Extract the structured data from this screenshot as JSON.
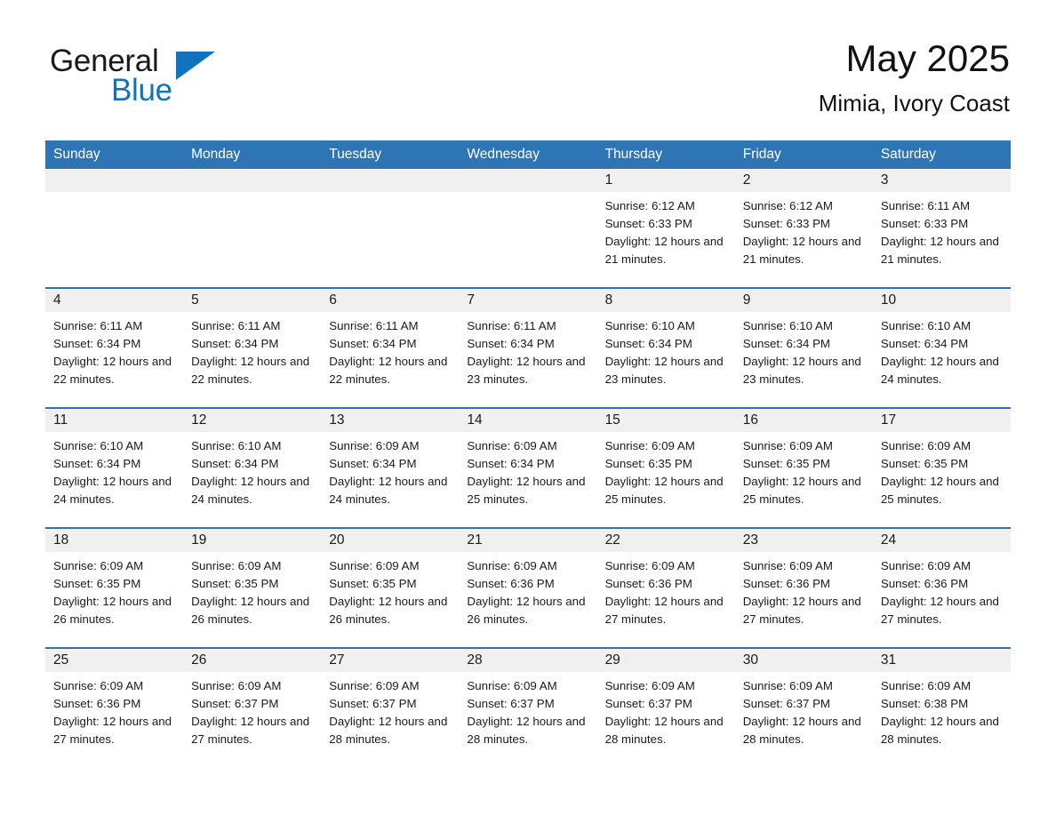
{
  "brand": {
    "name_part1": "General",
    "name_part2": "Blue",
    "accent_color": "#1073bd",
    "triangle_icon": "triangle-icon"
  },
  "header": {
    "title": "May 2025",
    "subtitle": "Mimia, Ivory Coast"
  },
  "theme": {
    "header_blue": "#2e75b6",
    "date_band_gray": "#f0f0f0",
    "text_black": "#1a1a1a"
  },
  "calendar": {
    "weekdays": [
      "Sunday",
      "Monday",
      "Tuesday",
      "Wednesday",
      "Thursday",
      "Friday",
      "Saturday"
    ],
    "weeks": [
      [
        {
          "day": "",
          "empty": true
        },
        {
          "day": "",
          "empty": true
        },
        {
          "day": "",
          "empty": true
        },
        {
          "day": "",
          "empty": true
        },
        {
          "day": "1",
          "sunrise": "Sunrise: 6:12 AM",
          "sunset": "Sunset: 6:33 PM",
          "daylight": "Daylight: 12 hours and 21 minutes."
        },
        {
          "day": "2",
          "sunrise": "Sunrise: 6:12 AM",
          "sunset": "Sunset: 6:33 PM",
          "daylight": "Daylight: 12 hours and 21 minutes."
        },
        {
          "day": "3",
          "sunrise": "Sunrise: 6:11 AM",
          "sunset": "Sunset: 6:33 PM",
          "daylight": "Daylight: 12 hours and 21 minutes."
        }
      ],
      [
        {
          "day": "4",
          "sunrise": "Sunrise: 6:11 AM",
          "sunset": "Sunset: 6:34 PM",
          "daylight": "Daylight: 12 hours and 22 minutes."
        },
        {
          "day": "5",
          "sunrise": "Sunrise: 6:11 AM",
          "sunset": "Sunset: 6:34 PM",
          "daylight": "Daylight: 12 hours and 22 minutes."
        },
        {
          "day": "6",
          "sunrise": "Sunrise: 6:11 AM",
          "sunset": "Sunset: 6:34 PM",
          "daylight": "Daylight: 12 hours and 22 minutes."
        },
        {
          "day": "7",
          "sunrise": "Sunrise: 6:11 AM",
          "sunset": "Sunset: 6:34 PM",
          "daylight": "Daylight: 12 hours and 23 minutes."
        },
        {
          "day": "8",
          "sunrise": "Sunrise: 6:10 AM",
          "sunset": "Sunset: 6:34 PM",
          "daylight": "Daylight: 12 hours and 23 minutes."
        },
        {
          "day": "9",
          "sunrise": "Sunrise: 6:10 AM",
          "sunset": "Sunset: 6:34 PM",
          "daylight": "Daylight: 12 hours and 23 minutes."
        },
        {
          "day": "10",
          "sunrise": "Sunrise: 6:10 AM",
          "sunset": "Sunset: 6:34 PM",
          "daylight": "Daylight: 12 hours and 24 minutes."
        }
      ],
      [
        {
          "day": "11",
          "sunrise": "Sunrise: 6:10 AM",
          "sunset": "Sunset: 6:34 PM",
          "daylight": "Daylight: 12 hours and 24 minutes."
        },
        {
          "day": "12",
          "sunrise": "Sunrise: 6:10 AM",
          "sunset": "Sunset: 6:34 PM",
          "daylight": "Daylight: 12 hours and 24 minutes."
        },
        {
          "day": "13",
          "sunrise": "Sunrise: 6:09 AM",
          "sunset": "Sunset: 6:34 PM",
          "daylight": "Daylight: 12 hours and 24 minutes."
        },
        {
          "day": "14",
          "sunrise": "Sunrise: 6:09 AM",
          "sunset": "Sunset: 6:34 PM",
          "daylight": "Daylight: 12 hours and 25 minutes."
        },
        {
          "day": "15",
          "sunrise": "Sunrise: 6:09 AM",
          "sunset": "Sunset: 6:35 PM",
          "daylight": "Daylight: 12 hours and 25 minutes."
        },
        {
          "day": "16",
          "sunrise": "Sunrise: 6:09 AM",
          "sunset": "Sunset: 6:35 PM",
          "daylight": "Daylight: 12 hours and 25 minutes."
        },
        {
          "day": "17",
          "sunrise": "Sunrise: 6:09 AM",
          "sunset": "Sunset: 6:35 PM",
          "daylight": "Daylight: 12 hours and 25 minutes."
        }
      ],
      [
        {
          "day": "18",
          "sunrise": "Sunrise: 6:09 AM",
          "sunset": "Sunset: 6:35 PM",
          "daylight": "Daylight: 12 hours and 26 minutes."
        },
        {
          "day": "19",
          "sunrise": "Sunrise: 6:09 AM",
          "sunset": "Sunset: 6:35 PM",
          "daylight": "Daylight: 12 hours and 26 minutes."
        },
        {
          "day": "20",
          "sunrise": "Sunrise: 6:09 AM",
          "sunset": "Sunset: 6:35 PM",
          "daylight": "Daylight: 12 hours and 26 minutes."
        },
        {
          "day": "21",
          "sunrise": "Sunrise: 6:09 AM",
          "sunset": "Sunset: 6:36 PM",
          "daylight": "Daylight: 12 hours and 26 minutes."
        },
        {
          "day": "22",
          "sunrise": "Sunrise: 6:09 AM",
          "sunset": "Sunset: 6:36 PM",
          "daylight": "Daylight: 12 hours and 27 minutes."
        },
        {
          "day": "23",
          "sunrise": "Sunrise: 6:09 AM",
          "sunset": "Sunset: 6:36 PM",
          "daylight": "Daylight: 12 hours and 27 minutes."
        },
        {
          "day": "24",
          "sunrise": "Sunrise: 6:09 AM",
          "sunset": "Sunset: 6:36 PM",
          "daylight": "Daylight: 12 hours and 27 minutes."
        }
      ],
      [
        {
          "day": "25",
          "sunrise": "Sunrise: 6:09 AM",
          "sunset": "Sunset: 6:36 PM",
          "daylight": "Daylight: 12 hours and 27 minutes."
        },
        {
          "day": "26",
          "sunrise": "Sunrise: 6:09 AM",
          "sunset": "Sunset: 6:37 PM",
          "daylight": "Daylight: 12 hours and 27 minutes."
        },
        {
          "day": "27",
          "sunrise": "Sunrise: 6:09 AM",
          "sunset": "Sunset: 6:37 PM",
          "daylight": "Daylight: 12 hours and 28 minutes."
        },
        {
          "day": "28",
          "sunrise": "Sunrise: 6:09 AM",
          "sunset": "Sunset: 6:37 PM",
          "daylight": "Daylight: 12 hours and 28 minutes."
        },
        {
          "day": "29",
          "sunrise": "Sunrise: 6:09 AM",
          "sunset": "Sunset: 6:37 PM",
          "daylight": "Daylight: 12 hours and 28 minutes."
        },
        {
          "day": "30",
          "sunrise": "Sunrise: 6:09 AM",
          "sunset": "Sunset: 6:37 PM",
          "daylight": "Daylight: 12 hours and 28 minutes."
        },
        {
          "day": "31",
          "sunrise": "Sunrise: 6:09 AM",
          "sunset": "Sunset: 6:38 PM",
          "daylight": "Daylight: 12 hours and 28 minutes."
        }
      ]
    ]
  }
}
